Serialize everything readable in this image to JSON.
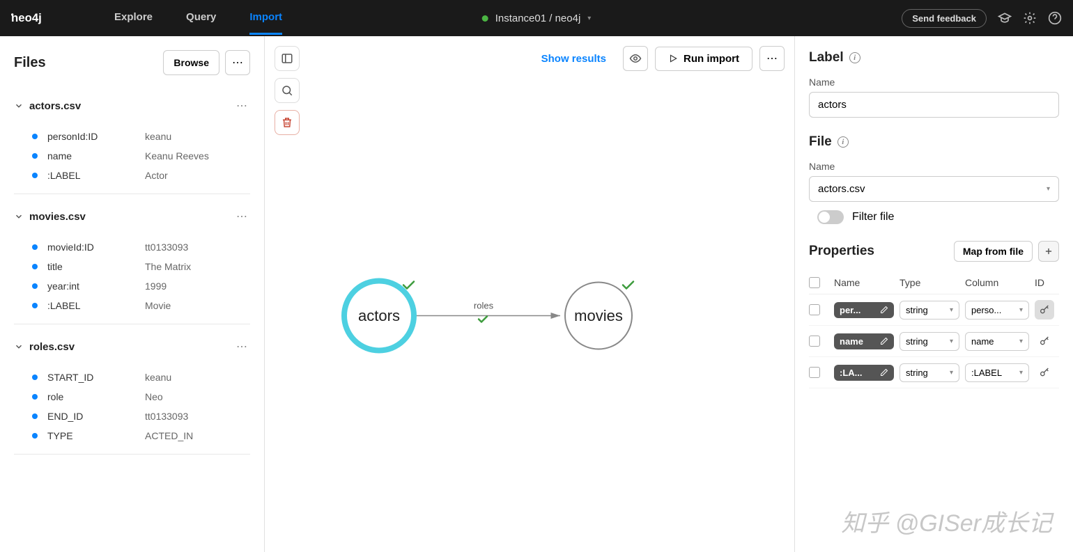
{
  "topbar": {
    "tabs": [
      "Explore",
      "Query",
      "Import"
    ],
    "active_tab": "Import",
    "instance": "Instance01 / neo4j",
    "feedback": "Send feedback"
  },
  "sidebar_left": {
    "title": "Files",
    "browse": "Browse",
    "files": [
      {
        "name": "actors.csv",
        "fields": [
          {
            "key": "personId:ID",
            "val": "keanu"
          },
          {
            "key": "name",
            "val": "Keanu Reeves"
          },
          {
            "key": ":LABEL",
            "val": "Actor"
          }
        ]
      },
      {
        "name": "movies.csv",
        "fields": [
          {
            "key": "movieId:ID",
            "val": "tt0133093"
          },
          {
            "key": "title",
            "val": "The Matrix"
          },
          {
            "key": "year:int",
            "val": "1999"
          },
          {
            "key": ":LABEL",
            "val": "Movie"
          }
        ]
      },
      {
        "name": "roles.csv",
        "fields": [
          {
            "key": "START_ID",
            "val": "keanu"
          },
          {
            "key": "role",
            "val": "Neo"
          },
          {
            "key": "END_ID",
            "val": "tt0133093"
          },
          {
            "key": "TYPE",
            "val": "ACTED_IN"
          }
        ]
      }
    ]
  },
  "canvas": {
    "show_results": "Show results",
    "run_import": "Run import",
    "nodes": [
      {
        "label": "actors",
        "selected": true
      },
      {
        "label": "movies",
        "selected": false
      }
    ],
    "edge_label": "roles"
  },
  "sidebar_right": {
    "label_heading": "Label",
    "name_label": "Name",
    "name_value": "actors",
    "file_heading": "File",
    "file_name_label": "Name",
    "file_value": "actors.csv",
    "filter_file": "Filter file",
    "props_heading": "Properties",
    "map_from_file": "Map from file",
    "headers": {
      "name": "Name",
      "type": "Type",
      "column": "Column",
      "id": "ID"
    },
    "rows": [
      {
        "name": "per...",
        "type": "string",
        "column": "perso...",
        "is_id": true
      },
      {
        "name": "name",
        "type": "string",
        "column": "name",
        "is_id": false
      },
      {
        "name": ":LA...",
        "type": "string",
        "column": ":LABEL",
        "is_id": false
      }
    ]
  },
  "watermark": "知乎 @GISer成长记"
}
